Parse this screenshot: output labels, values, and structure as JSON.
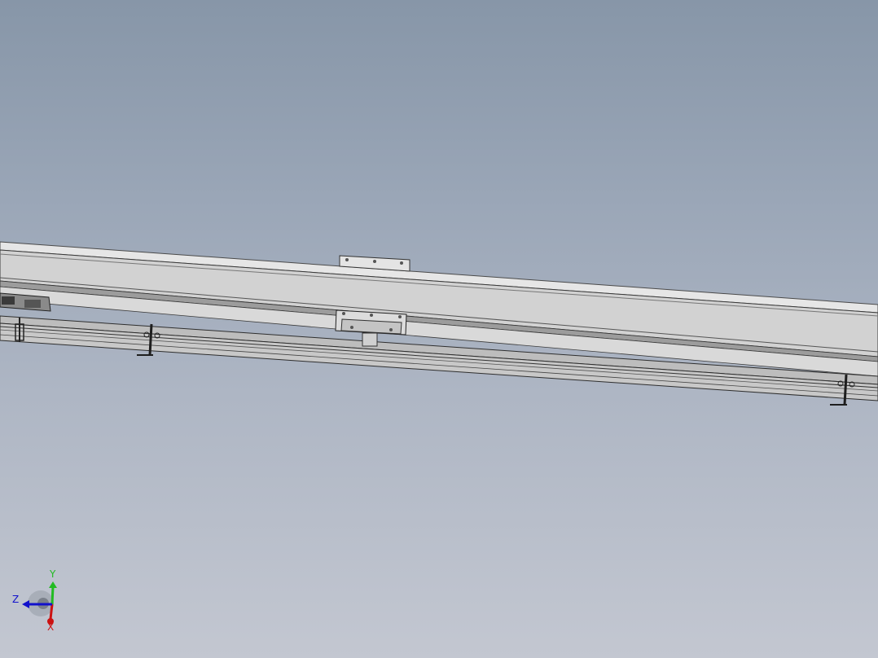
{
  "viewport": {
    "background_top": "#8796a8",
    "background_bottom": "#c3c7d1"
  },
  "model": {
    "description_colors": {
      "rail_top": "#e2e2e2",
      "rail_face": "#cfcfcf",
      "rail_edge": "#3a3a3a",
      "bracket": "#d8d8d8",
      "dark_part": "#2b2b2b"
    }
  },
  "triad": {
    "x_label": "X",
    "y_label": "Y",
    "z_label": "Z",
    "x_color": "#cc1111",
    "y_color": "#22bb22",
    "z_color": "#1111cc"
  }
}
